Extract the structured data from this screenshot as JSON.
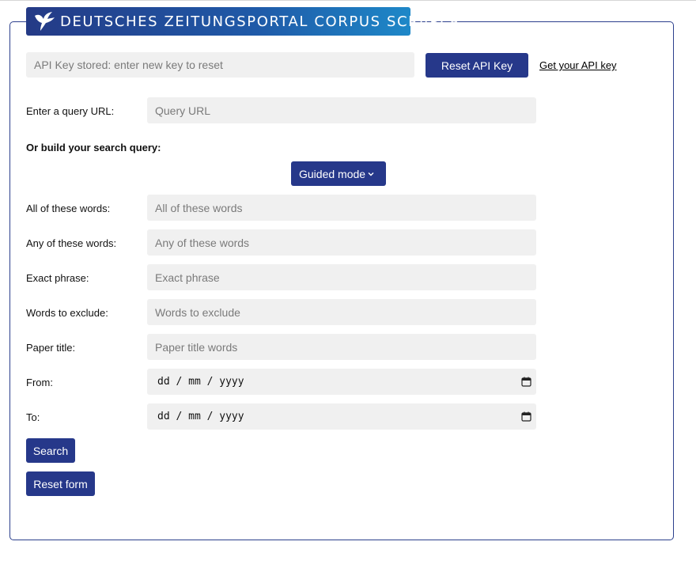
{
  "banner": {
    "title": "DEUTSCHES ZEITUNGSPORTAL CORPUS SCRAPER",
    "logo_icon": "dove-icon"
  },
  "api": {
    "placeholder": "API Key stored: enter new key to reset",
    "reset_label": "Reset API Key",
    "link_label": "Get your API key"
  },
  "query_url": {
    "label": "Enter a query URL:",
    "placeholder": "Query URL"
  },
  "build": {
    "heading": "Or build your search query:",
    "mode_selected": "Guided mode"
  },
  "fields": {
    "all": {
      "label": "All of these words:",
      "placeholder": "All of these words"
    },
    "any": {
      "label": "Any of these words:",
      "placeholder": "Any of these words"
    },
    "exact": {
      "label": "Exact phrase:",
      "placeholder": "Exact phrase"
    },
    "exclude": {
      "label": "Words to exclude:",
      "placeholder": "Words to exclude"
    },
    "paper": {
      "label": "Paper title:",
      "placeholder": "Paper title words"
    },
    "from": {
      "label": "From:",
      "value": "dd / mm / yyyy"
    },
    "to": {
      "label": "To:",
      "value": "dd / mm / yyyy"
    }
  },
  "actions": {
    "search_label": "Search",
    "reset_label": "Reset form"
  },
  "colors": {
    "primary": "#26388a",
    "input_bg": "#f0f0f0",
    "banner_end": "#1e88c8"
  }
}
